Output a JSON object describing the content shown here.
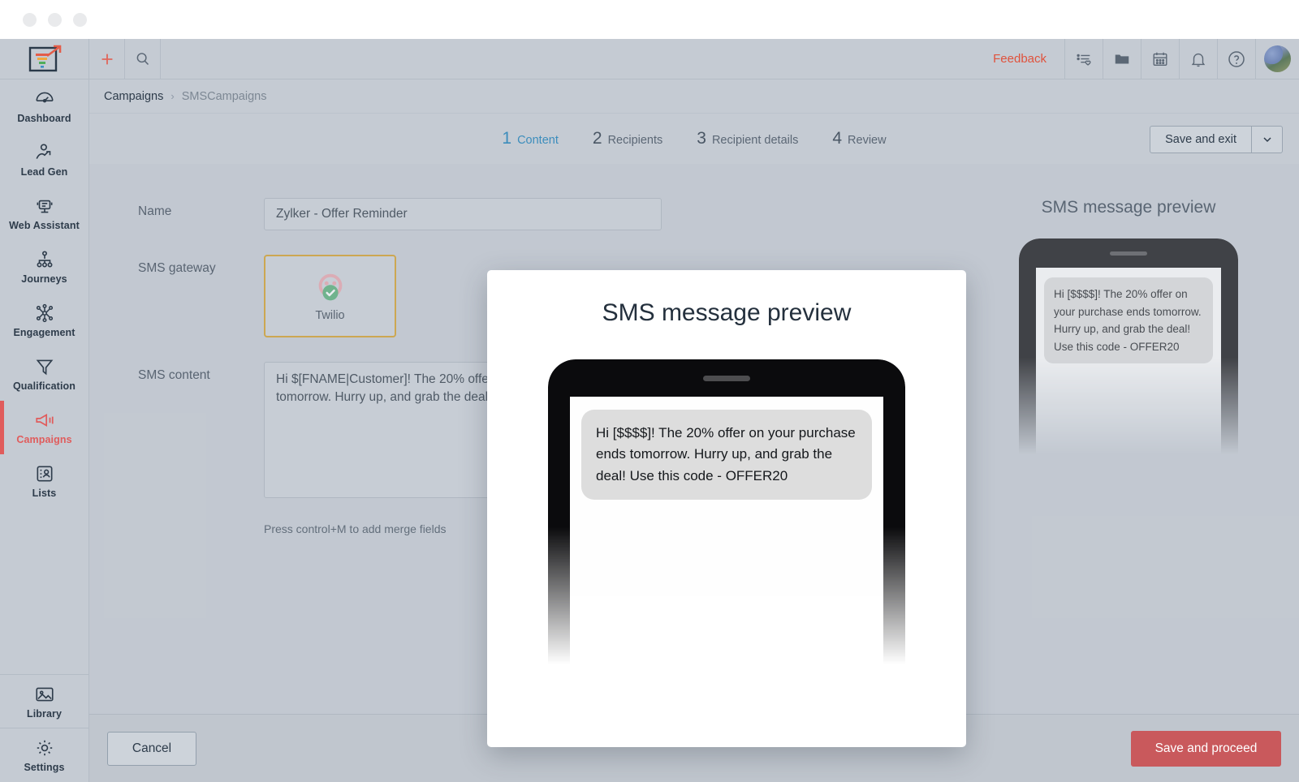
{
  "window": {
    "controls": [
      "close",
      "minimize",
      "zoom"
    ]
  },
  "sidebar": {
    "logo_name": "zoho-marketing-logo",
    "items": [
      {
        "label": "Dashboard",
        "icon": "gauge-icon",
        "active": false
      },
      {
        "label": "Lead Gen",
        "icon": "lead-gen-icon",
        "active": false
      },
      {
        "label": "Web Assistant",
        "icon": "web-assistant-icon",
        "active": false
      },
      {
        "label": "Journeys",
        "icon": "journeys-icon",
        "active": false
      },
      {
        "label": "Engagement",
        "icon": "engagement-icon",
        "active": false
      },
      {
        "label": "Qualification",
        "icon": "funnel-icon",
        "active": false
      },
      {
        "label": "Campaigns",
        "icon": "megaphone-icon",
        "active": true
      },
      {
        "label": "Lists",
        "icon": "lists-icon",
        "active": false
      }
    ],
    "bottom_items": [
      {
        "label": "Library",
        "icon": "image-icon"
      },
      {
        "label": "Settings",
        "icon": "gear-icon"
      }
    ],
    "active_color": "#e05c5c"
  },
  "topbar": {
    "add_icon": "plus-icon",
    "search_icon": "search-icon",
    "feedback_label": "Feedback",
    "feedback_color": "#e0523c",
    "right_icons": [
      "checklist-heart-icon",
      "folder-icon",
      "calendar-icon",
      "bell-icon",
      "help-icon"
    ],
    "avatar_name": "user-avatar"
  },
  "breadcrumb": {
    "parent": "Campaigns",
    "separator": "›",
    "current": "SMSCampaigns"
  },
  "steps": {
    "active_color": "#3c8dbc",
    "items": [
      {
        "num": "1",
        "label": "Content",
        "active": true
      },
      {
        "num": "2",
        "label": "Recipients",
        "active": false
      },
      {
        "num": "3",
        "label": "Recipient details",
        "active": false
      },
      {
        "num": "4",
        "label": "Review",
        "active": false
      }
    ]
  },
  "save_exit": {
    "label": "Save and exit",
    "caret": "chevron-down-icon"
  },
  "form": {
    "name_label": "Name",
    "name_value": "Zylker - Offer Reminder",
    "gateway_label": "SMS gateway",
    "gateway_name": "Twilio",
    "gateway_selected_border": "#d39b1d",
    "content_label": "SMS content",
    "content_value": "Hi $[FNAME|Customer]! The 20% offer on your purchase ends tomorrow. Hurry up, and grab the deal! Use this code - OFFER20",
    "hint": "Press control+M to add merge fields"
  },
  "preview_panel": {
    "title": "SMS message preview",
    "message": "Hi [$$$$]! The 20% offer on your purchase ends tomorrow. Hurry up, and grab the deal! Use this code - OFFER20"
  },
  "modal": {
    "title": "SMS message preview",
    "message": "Hi [$$$$]! The 20% offer on your purchase ends tomorrow. Hurry up, and grab the deal! Use this code - OFFER20"
  },
  "footer": {
    "cancel_label": "Cancel",
    "proceed_label": "Save and proceed",
    "proceed_color": "#c9595c"
  }
}
